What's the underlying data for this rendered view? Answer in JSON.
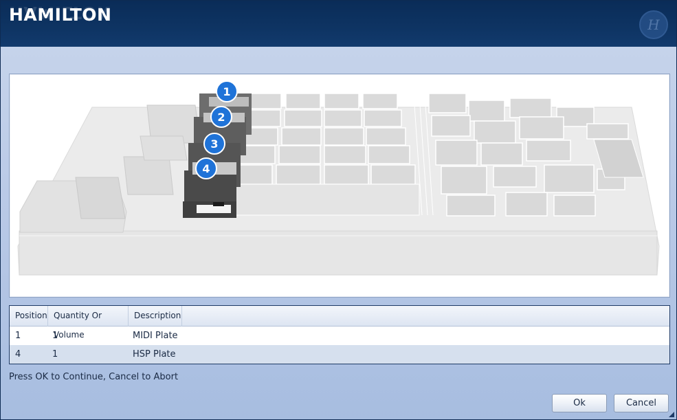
{
  "app": {
    "brand": "HAMILTON"
  },
  "deck": {
    "markers": [
      {
        "label": "1"
      },
      {
        "label": "2"
      },
      {
        "label": "3"
      },
      {
        "label": "4"
      }
    ]
  },
  "table": {
    "headers": [
      "Position",
      "Quantity Or Volume",
      "Description"
    ],
    "rows": [
      {
        "position": "1",
        "quantity": "1",
        "description": "MIDI Plate"
      },
      {
        "position": "4",
        "quantity": "1",
        "description": "HSP Plate"
      }
    ]
  },
  "status": "Press OK to Continue, Cancel to Abort",
  "buttons": {
    "ok": "Ok",
    "cancel": "Cancel"
  },
  "colors": {
    "banner": "#0e3463",
    "marker": "#1f73d8",
    "selected_row": "#d6e0ee"
  }
}
